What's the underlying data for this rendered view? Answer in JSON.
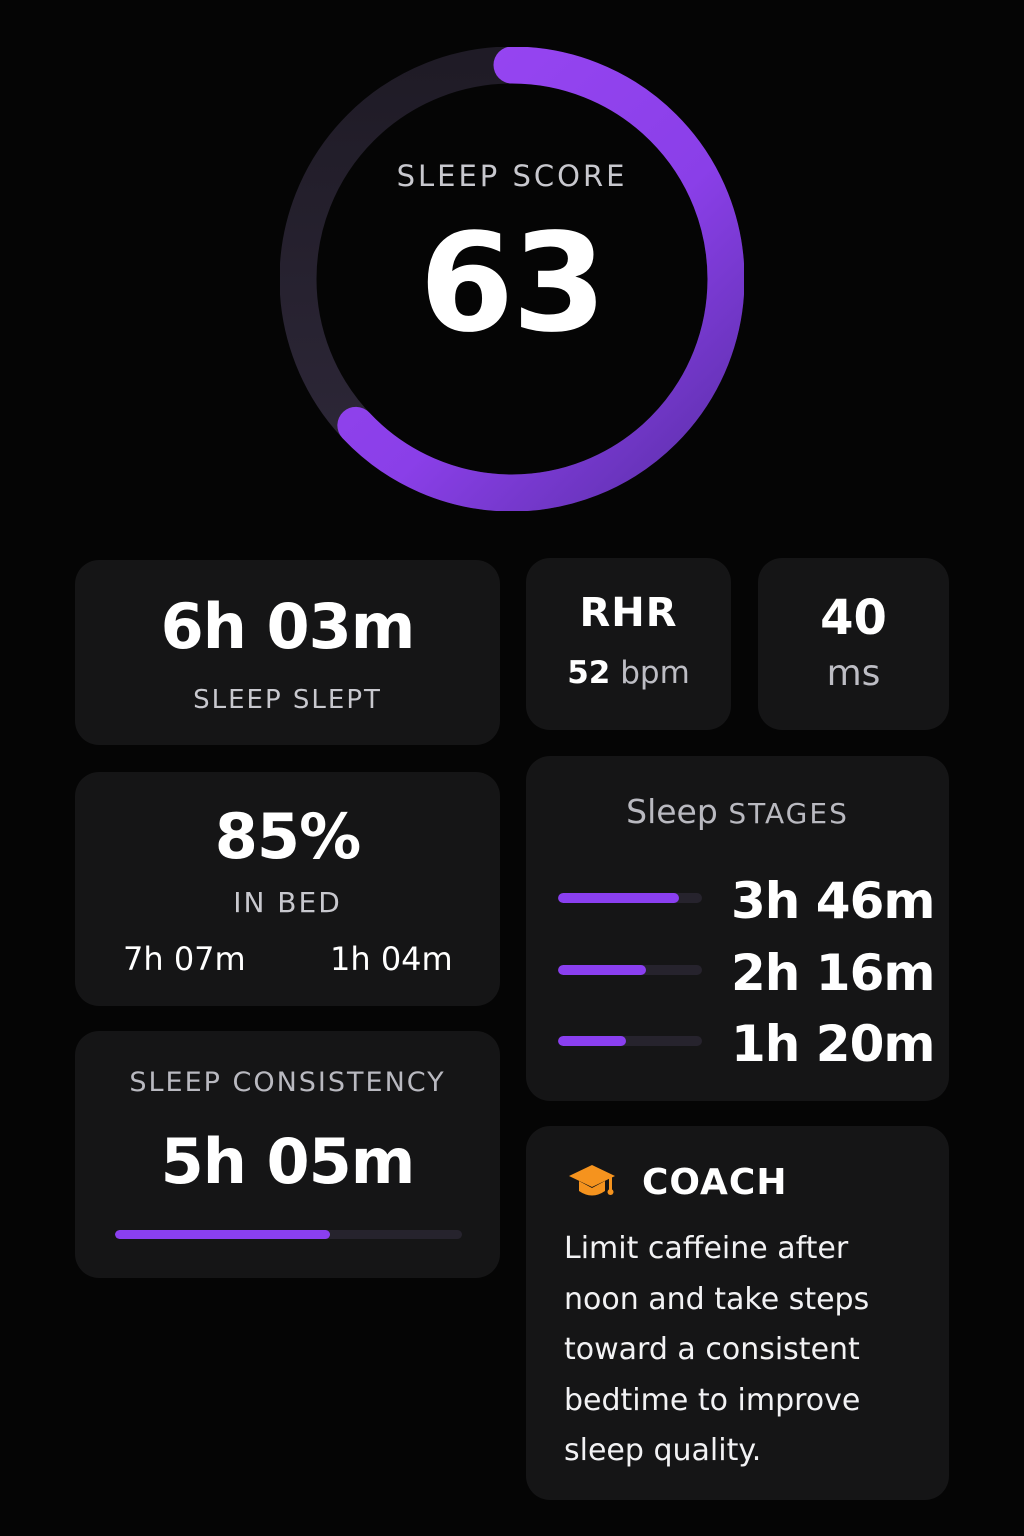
{
  "score": {
    "label": "SLEEP SCORE",
    "value": "63",
    "progress_fraction": 0.63,
    "ring_color": "#9b48f5",
    "track_color": "#2a2533"
  },
  "duration": {
    "value": "6h 03m",
    "label": "SLEEP SLEPT"
  },
  "rhr": {
    "label": "RHR",
    "value": "52",
    "unit": "bpm"
  },
  "hrv": {
    "value": "40",
    "unit": "ms"
  },
  "efficiency": {
    "value": "85%",
    "label": "IN BED",
    "time_in_bed": "7h 07m",
    "time_awake": "1h 04m"
  },
  "consistency": {
    "label": "SLEEP CONSISTENCY",
    "value": "5h 05m",
    "progress_fraction": 0.62
  },
  "stages": {
    "label_prefix": "Sleep",
    "label_suffix": "STAGES",
    "rows": [
      {
        "value": "3h 46m",
        "fraction": 0.84
      },
      {
        "value": "2h 16m",
        "fraction": 0.61
      },
      {
        "value": "1h 20m",
        "fraction": 0.47
      }
    ]
  },
  "coach": {
    "icon": "graduation-cap-icon",
    "icon_color": "#f5931e",
    "title": "COACH",
    "message": "Limit caffeine after noon and take steps toward a consistent bedtime to improve sleep quality."
  },
  "colors": {
    "accent": "#8a3ff0",
    "background": "#050505",
    "card": "#151516"
  }
}
